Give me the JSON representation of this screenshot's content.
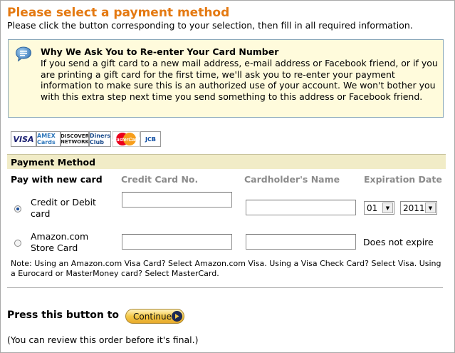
{
  "page": {
    "title": "Please select a payment method",
    "instructions": "Please click the button corresponding to your selection, then fill in all required information."
  },
  "info_box": {
    "icon": "speech-bubble-icon",
    "heading": "Why We Ask You to Re-enter Your Card Number",
    "body": "If you send a gift card to a new mail address, e-mail address or Facebook friend, or if you are printing a gift card for the first time, we'll ask you to re-enter your payment information to make sure this is an authorized use of your account. We won't bother you with this extra step next time you send something to this address or Facebook friend."
  },
  "card_logos": {
    "visa": "VISA",
    "amex": "AMEX Cards",
    "discover": "DISCOVER NETWORK",
    "diners": "Diners Club",
    "mastercard": "MasterCard",
    "jcb": "JCB"
  },
  "payment_method": {
    "header": "Payment Method",
    "columns": {
      "pay_with": "Pay with new card",
      "card_no": "Credit Card No.",
      "holder": "Cardholder's Name",
      "expiration": "Expiration Date"
    },
    "options": [
      {
        "label_line1": "Credit or Debit",
        "label_line2": "card",
        "selected": true,
        "card_number": "",
        "holder_name": "",
        "exp_month": "01",
        "exp_year": "2011"
      },
      {
        "label_line1": "Amazon.com",
        "label_line2": "Store Card",
        "selected": false,
        "card_number": "",
        "holder_name": "",
        "expiry_text": "Does not expire"
      }
    ],
    "note": "Note: Using an Amazon.com Visa Card? Select Amazon.com Visa. Using a Visa Check Card? Select Visa. Using a Eurocard or MasterMoney card? Select MasterCard."
  },
  "footer": {
    "press_label": "Press this button to",
    "continue_label": "Continue",
    "review_note": "(You can review this order before it's final.)"
  },
  "colors": {
    "title": "#e47911",
    "info_bg": "#fffbdc",
    "header_bg": "#f1ecc7",
    "muted_heading": "#8b8b8b"
  }
}
